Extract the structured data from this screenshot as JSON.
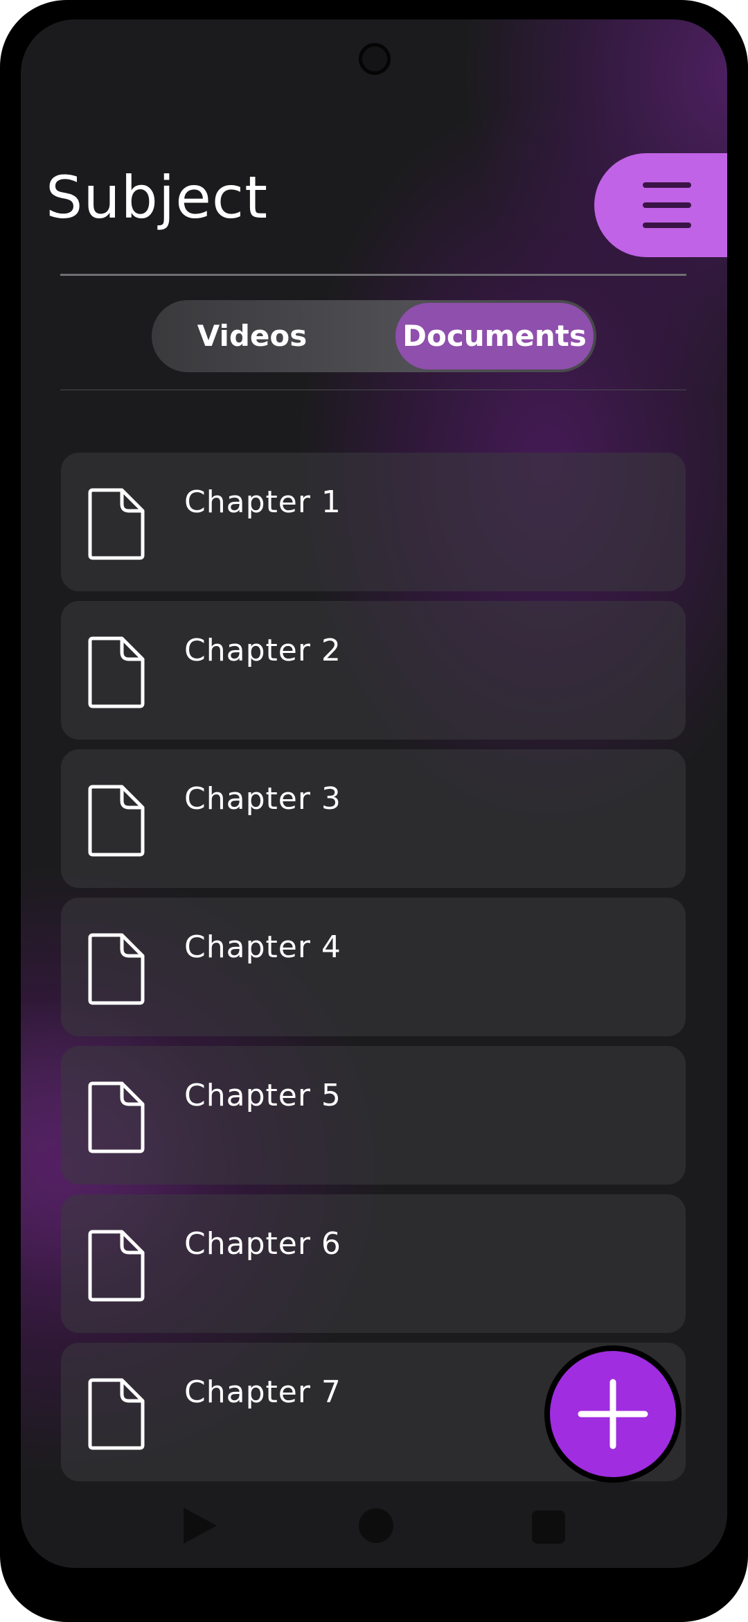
{
  "header": {
    "title": "Subject",
    "menu_icon": "hamburger-menu-icon"
  },
  "tabs": {
    "items": [
      {
        "label": "Videos",
        "selected": false
      },
      {
        "label": "Documents",
        "selected": true
      }
    ]
  },
  "chapters": {
    "icon": "document-icon",
    "items": [
      {
        "label": "Chapter 1"
      },
      {
        "label": "Chapter 2"
      },
      {
        "label": "Chapter 3"
      },
      {
        "label": "Chapter 4"
      },
      {
        "label": "Chapter 5"
      },
      {
        "label": "Chapter 6"
      },
      {
        "label": "Chapter 7"
      }
    ]
  },
  "fab": {
    "icon": "plus-icon"
  },
  "navigation_bar": {
    "icons": [
      "back-triangle-icon",
      "home-circle-icon",
      "recents-square-icon"
    ]
  },
  "colors": {
    "accent": "#c063e6",
    "selected_tab": "#8f4fad",
    "fab": "#a02de0",
    "background": "#1b1b1d",
    "text": "#ffffff"
  }
}
